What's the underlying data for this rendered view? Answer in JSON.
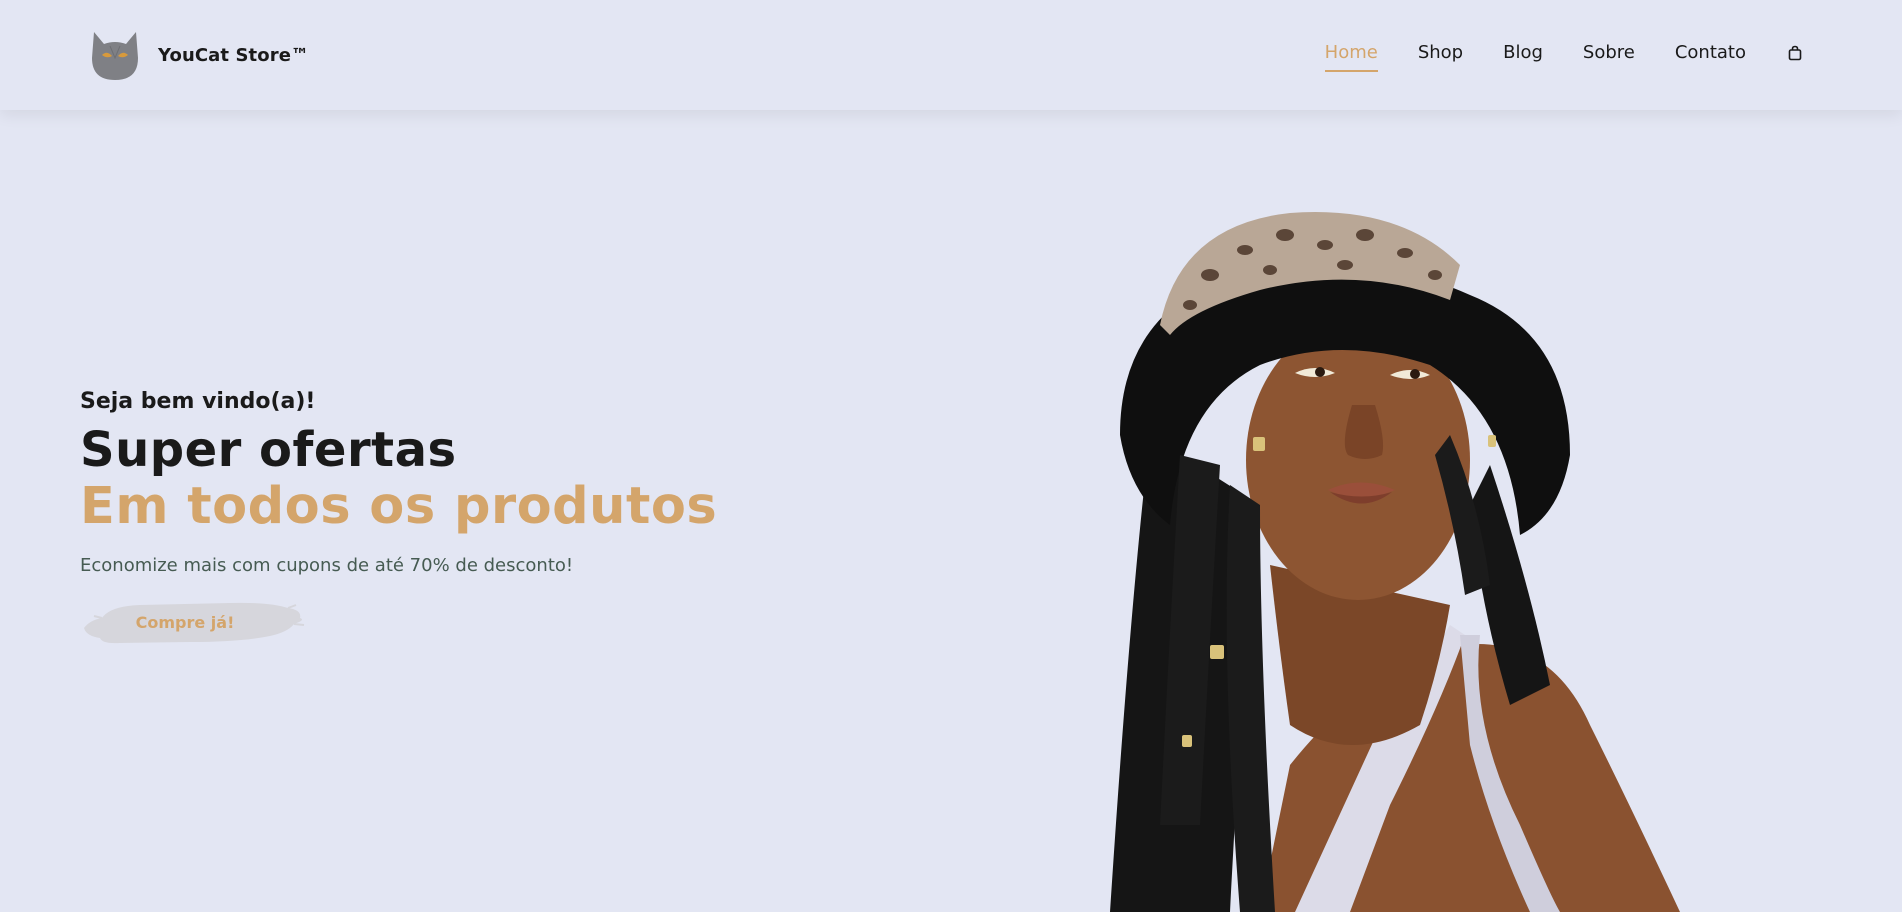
{
  "header": {
    "brand": {
      "logo_icon": "cat-head-icon",
      "name": "YouCat Store™"
    },
    "nav": {
      "items": [
        {
          "label": "Home",
          "active": true
        },
        {
          "label": "Shop",
          "active": false
        },
        {
          "label": "Blog",
          "active": false
        },
        {
          "label": "Sobre",
          "active": false
        },
        {
          "label": "Contato",
          "active": false
        }
      ],
      "cart_icon": "shopping-bag-icon"
    }
  },
  "hero": {
    "greeting": "Seja bem vindo(a)!",
    "title": "Super ofertas",
    "subtitle": "Em todos os produtos",
    "description": "Economize mais com cupons de até 70% de desconto!",
    "cta_label": "Compre já!"
  },
  "colors": {
    "background": "#e3e6f3",
    "accent": "#d4a56b",
    "text": "#1a1a1a",
    "muted_text": "#465b52"
  }
}
